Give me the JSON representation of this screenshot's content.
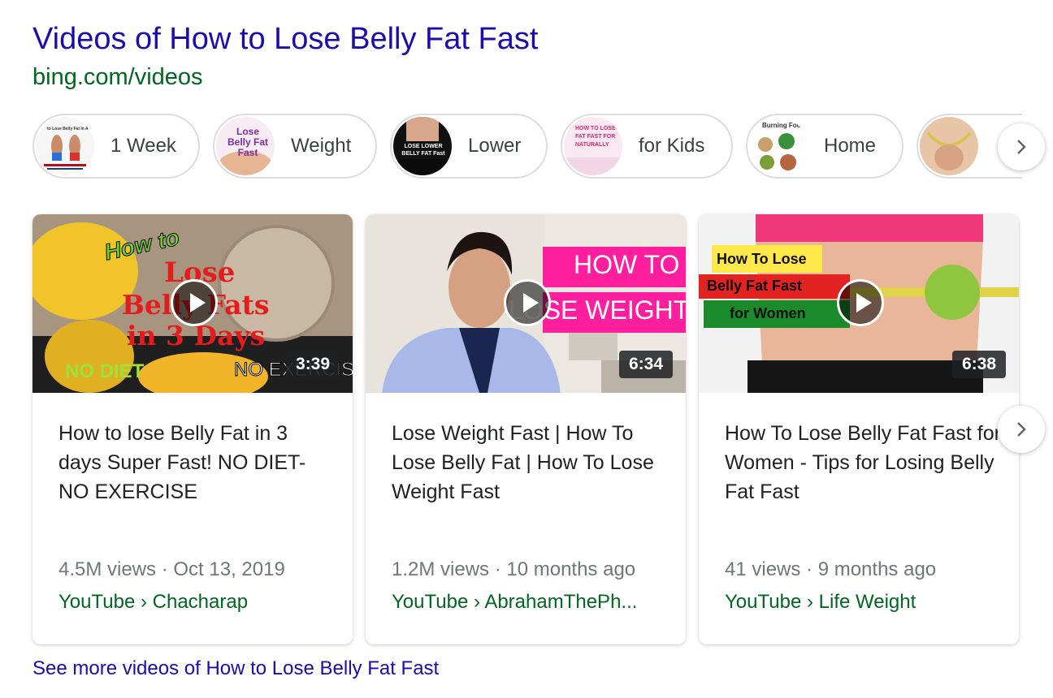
{
  "header": {
    "title": "Videos of How to Lose Belly Fat Fast",
    "url": "bing.com/videos"
  },
  "chips": [
    {
      "label": "1 Week",
      "thumb_text": "to Lose Belly Fat In A"
    },
    {
      "label": "Weight",
      "thumb_text": "Lose Belly Fat Fast"
    },
    {
      "label": "Lower",
      "thumb_text": "LOSE LOWER BELLY FAT Fast"
    },
    {
      "label": "for Kids",
      "thumb_text": "HOW TO LOSE FAT FAST FOR NATURALLY"
    },
    {
      "label": "Home",
      "thumb_text": "Burning Food"
    },
    {
      "label": "",
      "thumb_text": ""
    }
  ],
  "videos": [
    {
      "duration": "3:39",
      "title": "How to lose Belly Fat in 3 days Super Fast! NO DIET-NO EXERCISE",
      "meta": "4.5M views · Oct 13, 2019",
      "source": "YouTube › Chacharap",
      "thumb": {
        "howto": "How to",
        "line1": "Lose",
        "line2": "Belly Fats",
        "line3": "in 3 Days",
        "nodiet": "NO DIET",
        "noexercise": "NO EXERCISE"
      }
    },
    {
      "duration": "6:34",
      "title": "Lose Weight Fast | How To Lose Belly Fat | How To Lose Weight Fast",
      "meta": "1.2M views · 10 months ago",
      "source": "YouTube › AbrahamThePh...",
      "thumb": {
        "line1": "HOW TO",
        "line2": "LOSE WEIGHT"
      }
    },
    {
      "duration": "6:38",
      "title": "How To Lose Belly Fat Fast for Women - Tips for Losing Belly Fat Fast",
      "meta": "41 views · 9 months ago",
      "source": "YouTube › Life Weight",
      "thumb": {
        "line1": "How To Lose",
        "line2": "Belly Fat Fast",
        "line3": "for Women"
      }
    }
  ],
  "see_more": "See more videos of How to Lose Belly Fat Fast",
  "icons": {
    "next": "chevron-right-icon",
    "play": "play-icon"
  },
  "colors": {
    "link": "#1a0dab",
    "url": "#006621",
    "meta": "#70757a"
  }
}
